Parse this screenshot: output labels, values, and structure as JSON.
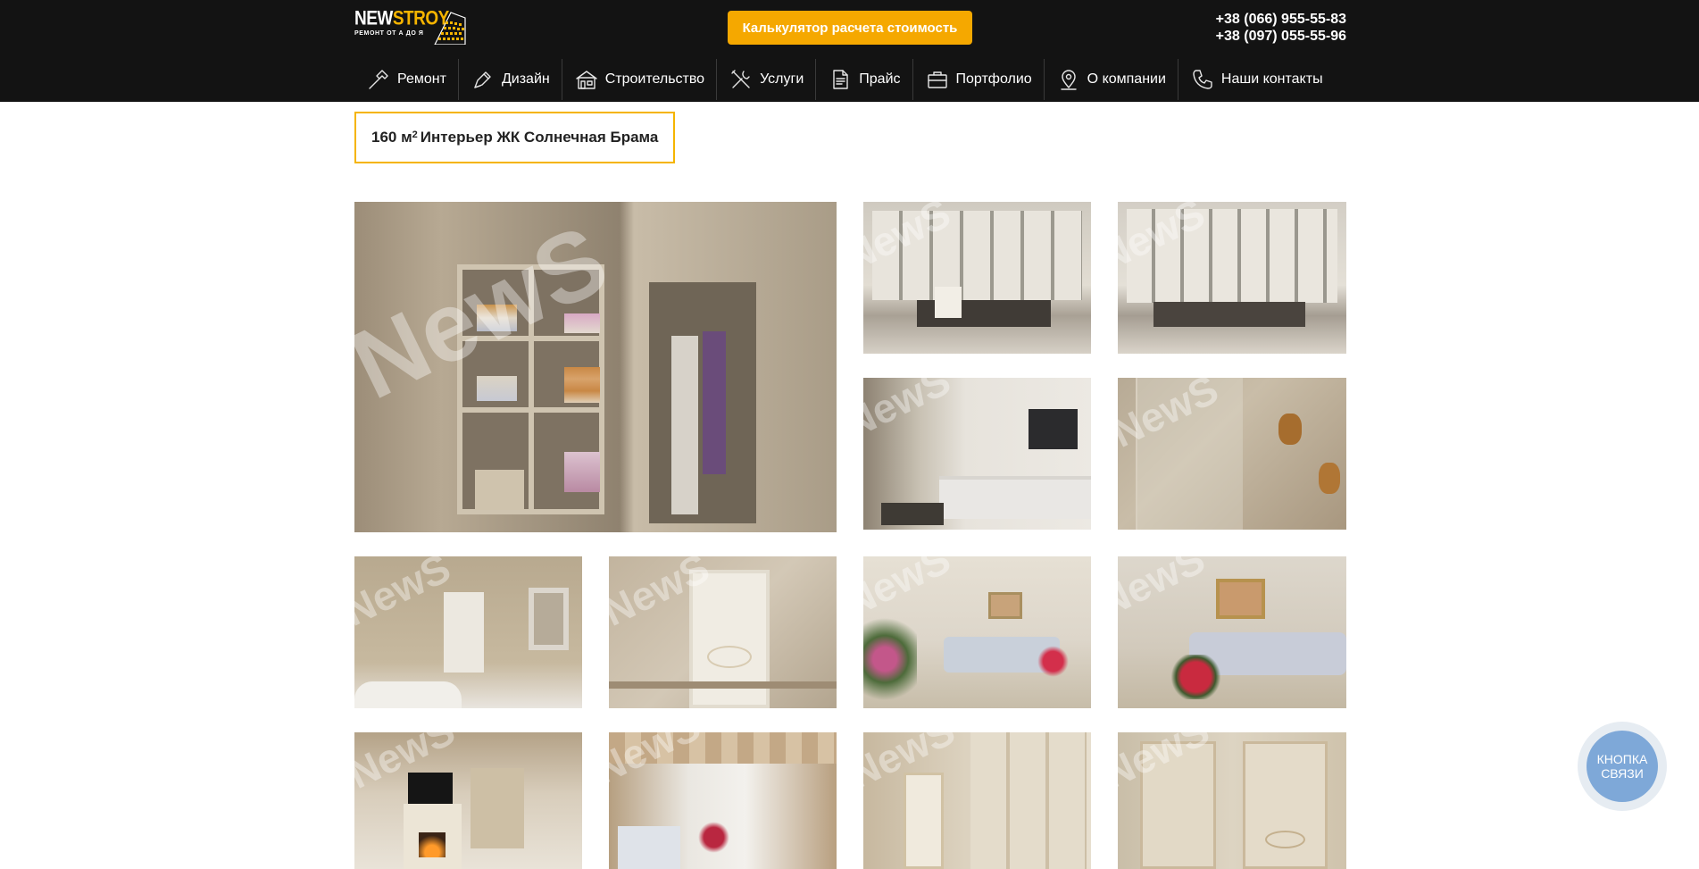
{
  "header": {
    "logo": {
      "brand_main": "NEW",
      "brand_accent": "STROY",
      "tagline": "РЕМОНТ ОТ А ДО Я"
    },
    "calc_button_label": "Калькулятор расчета стоимость",
    "phones": [
      "+38 (066) 955-55-83",
      "+38 (097) 055-55-96"
    ],
    "accent_color": "#f5b400"
  },
  "nav": {
    "items": [
      {
        "label": "Ремонт",
        "icon": "hammer-icon"
      },
      {
        "label": "Дизайн",
        "icon": "pen-brush-icon"
      },
      {
        "label": "Строительство",
        "icon": "house-icon"
      },
      {
        "label": "Услуги",
        "icon": "tools-icon"
      },
      {
        "label": "Прайс",
        "icon": "document-icon"
      },
      {
        "label": "Портфолио",
        "icon": "briefcase-icon"
      },
      {
        "label": "О компании",
        "icon": "map-pin-icon"
      },
      {
        "label": "Наши контакты",
        "icon": "phone-icon"
      }
    ]
  },
  "page": {
    "title_number": "160 м",
    "title_sup": "2",
    "title_text": " Интерьер ЖК Солнечная Брама"
  },
  "gallery": {
    "watermark": "NewS",
    "images": [
      {
        "scene": "wardrobe-closet"
      },
      {
        "scene": "study-cabinets"
      },
      {
        "scene": "study-cabinets-2"
      },
      {
        "scene": "living-room-sofa-tv"
      },
      {
        "scene": "bathroom-shower"
      },
      {
        "scene": "bathroom-bath-mirror"
      },
      {
        "scene": "interior-door"
      },
      {
        "scene": "living-room-flowers"
      },
      {
        "scene": "living-room-sofa"
      },
      {
        "scene": "living-room-fireplace"
      },
      {
        "scene": "living-room-curtains"
      },
      {
        "scene": "hallway"
      },
      {
        "scene": "hallway-doors"
      }
    ]
  },
  "callback": {
    "label_line1": "КНОПКА",
    "label_line2": "СВЯЗИ",
    "color": "#7ea8d8"
  }
}
